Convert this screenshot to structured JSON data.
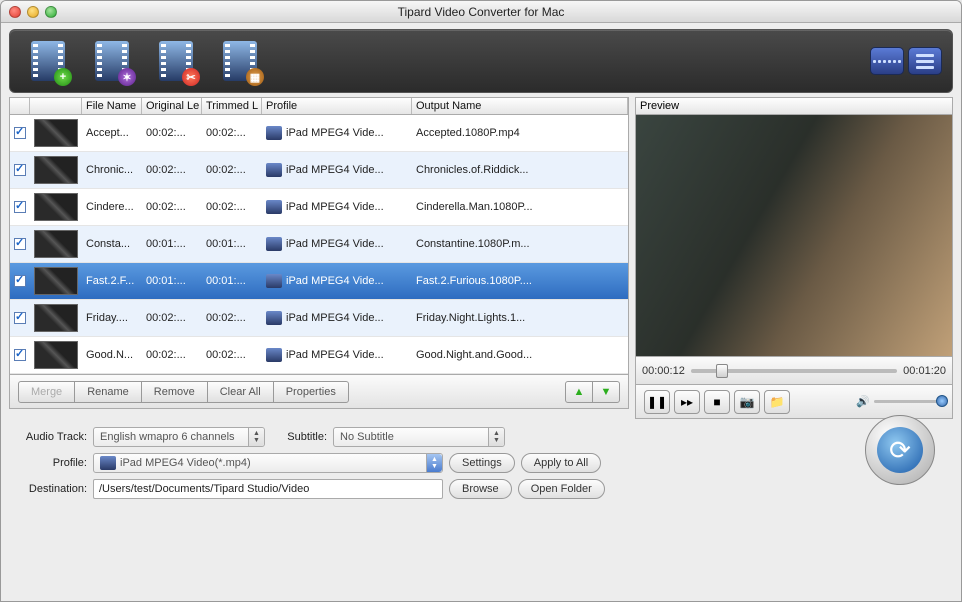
{
  "window_title": "Tipard Video Converter for Mac",
  "columns": {
    "c0": "",
    "c1": "",
    "c2": "File Name",
    "c3": "Original Le",
    "c4": "Trimmed L",
    "c5": "Profile",
    "c6": "Output Name"
  },
  "files": [
    {
      "name": "Accept...",
      "orig": "00:02:...",
      "trim": "00:02:...",
      "profile": "iPad MPEG4 Vide...",
      "output": "Accepted.1080P.mp4"
    },
    {
      "name": "Chronic...",
      "orig": "00:02:...",
      "trim": "00:02:...",
      "profile": "iPad MPEG4 Vide...",
      "output": "Chronicles.of.Riddick..."
    },
    {
      "name": "Cindere...",
      "orig": "00:02:...",
      "trim": "00:02:...",
      "profile": "iPad MPEG4 Vide...",
      "output": "Cinderella.Man.1080P..."
    },
    {
      "name": "Consta...",
      "orig": "00:01:...",
      "trim": "00:01:...",
      "profile": "iPad MPEG4 Vide...",
      "output": "Constantine.1080P.m..."
    },
    {
      "name": "Fast.2.F...",
      "orig": "00:01:...",
      "trim": "00:01:...",
      "profile": "iPad MPEG4 Vide...",
      "output": "Fast.2.Furious.1080P...."
    },
    {
      "name": "Friday....",
      "orig": "00:02:...",
      "trim": "00:02:...",
      "profile": "iPad MPEG4 Vide...",
      "output": "Friday.Night.Lights.1..."
    },
    {
      "name": "Good.N...",
      "orig": "00:02:...",
      "trim": "00:02:...",
      "profile": "iPad MPEG4 Vide...",
      "output": "Good.Night.and.Good..."
    }
  ],
  "selected_index": 4,
  "list_buttons": {
    "merge": "Merge",
    "rename": "Rename",
    "remove": "Remove",
    "clear": "Clear All",
    "props": "Properties"
  },
  "preview_label": "Preview",
  "time": {
    "current": "00:00:12",
    "total": "00:01:20"
  },
  "labels": {
    "audio": "Audio Track:",
    "subtitle": "Subtitle:",
    "profile": "Profile:",
    "dest": "Destination:"
  },
  "audio_track": "English wmapro 6 channels",
  "subtitle": "No Subtitle",
  "profile": "iPad MPEG4 Video(*.mp4)",
  "destination": "/Users/test/Documents/Tipard Studio/Video",
  "side_buttons": {
    "settings": "Settings",
    "apply": "Apply to All",
    "browse": "Browse",
    "open": "Open Folder"
  }
}
